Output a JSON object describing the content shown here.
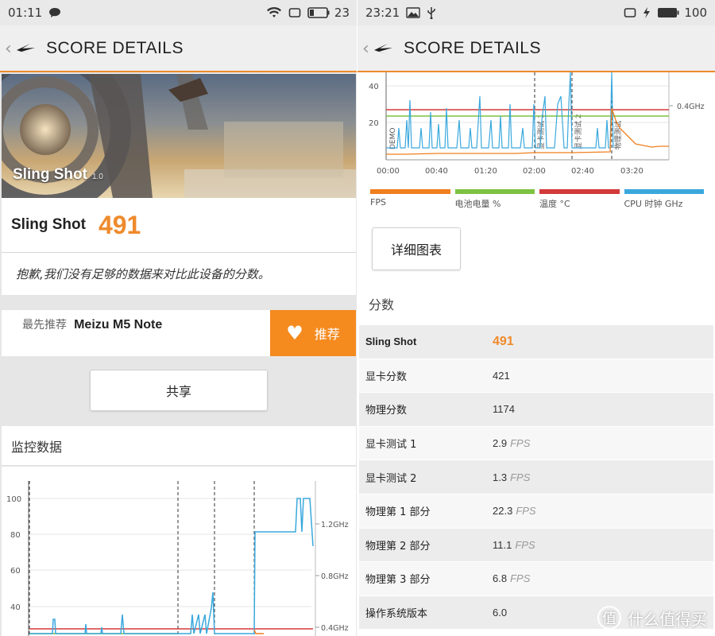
{
  "left": {
    "status": {
      "time": "01:11",
      "battery": "23"
    },
    "header": {
      "title": "SCORE DETAILS"
    },
    "hero": {
      "title": "Sling Shot",
      "version": "1.0"
    },
    "score": {
      "name": "Sling Shot",
      "value": "491"
    },
    "note": "抱歉,我们没有足够的数据来对比此设备的分数。",
    "recommend": {
      "prefix": "最先推荐",
      "device": "Meizu M5 Note",
      "button": "推荐"
    },
    "share_button": "共享",
    "monitor_title": "监控数据",
    "chart_labels": {
      "y": [
        "100",
        "80",
        "60",
        "40"
      ],
      "freq": [
        "1.2GHz",
        "0.8GHz",
        "0.4GHz"
      ]
    }
  },
  "right": {
    "status": {
      "time": "23:21",
      "battery": "100"
    },
    "header": {
      "title": "SCORE DETAILS"
    },
    "chart_labels": {
      "y": [
        "40",
        "20"
      ],
      "freq": [
        "0.4GHz"
      ],
      "x": [
        "00:00",
        "00:40",
        "01:20",
        "02:00",
        "02:40",
        "03:20"
      ],
      "markers": [
        "DEMO",
        "显卡测试 1",
        "显卡测试 2",
        "物理测试"
      ]
    },
    "legend": [
      {
        "label": "FPS",
        "color": "#f07f1f"
      },
      {
        "label": "电池电量 %",
        "color": "#7dc242"
      },
      {
        "label": "温度 °C",
        "color": "#d33a3a"
      },
      {
        "label": "CPU 时钟 GHz",
        "color": "#3aa8dd"
      }
    ],
    "detail_button": "详细图表",
    "scores_title": "分数",
    "rows": [
      {
        "label": "Sling Shot",
        "value": "491",
        "unit": ""
      },
      {
        "label": "显卡分数",
        "value": "421",
        "unit": ""
      },
      {
        "label": "物理分数",
        "value": "1174",
        "unit": ""
      },
      {
        "label": "显卡测试 1",
        "value": "2.9",
        "unit": "FPS"
      },
      {
        "label": "显卡测试 2",
        "value": "1.3",
        "unit": "FPS"
      },
      {
        "label": "物理第 1 部分",
        "value": "22.3",
        "unit": "FPS"
      },
      {
        "label": "物理第 2 部分",
        "value": "11.1",
        "unit": "FPS"
      },
      {
        "label": "物理第 3 部分",
        "value": "6.8",
        "unit": "FPS"
      },
      {
        "label": "操作系统版本",
        "value": "6.0",
        "unit": ""
      }
    ],
    "watermark": "什么值得买"
  }
}
